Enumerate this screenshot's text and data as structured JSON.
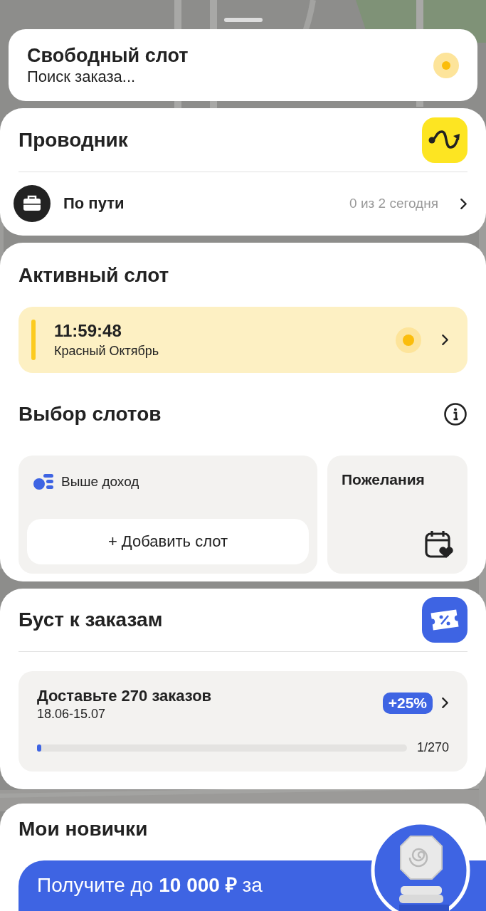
{
  "free_slot": {
    "title": "Свободный слот",
    "status": "Поиск заказа..."
  },
  "guide": {
    "title": "Проводник",
    "route": {
      "label": "По пути",
      "count": "0 из 2 сегодня"
    }
  },
  "active_slot": {
    "title": "Активный слот",
    "slot": {
      "time": "11:59:48",
      "place": "Красный Октябрь"
    }
  },
  "slot_choice": {
    "title": "Выбор слотов",
    "hint": "Выше доход",
    "add_button": "+ Добавить слот",
    "wishes": "Пожелания"
  },
  "boost": {
    "title": "Буст к заказам",
    "task": {
      "title": "Доставьте 270 заказов",
      "dates": "18.06-15.07",
      "badge": "+25%",
      "level": 0.012,
      "progress": "1/270"
    }
  },
  "newcomers": {
    "title": "Мои новички",
    "banner": "Получите до **10 000 ₽** за"
  }
}
